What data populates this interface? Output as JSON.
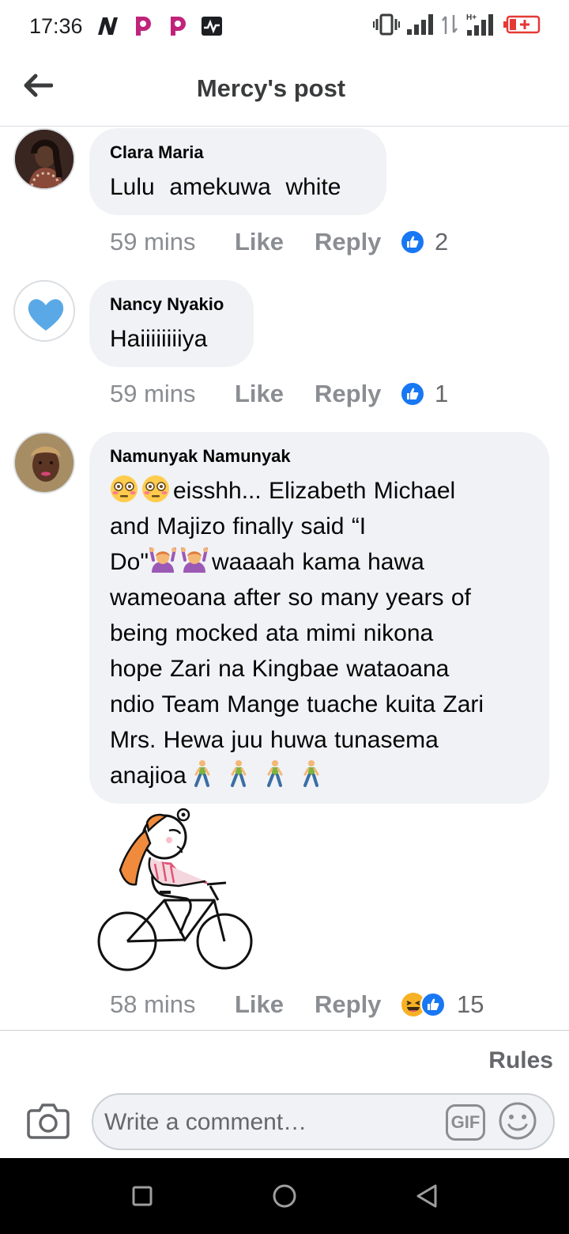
{
  "status_bar": {
    "time": "17:36",
    "left_icons": [
      "n-icon",
      "pinterest-icon",
      "pinterest-icon",
      "activity-icon"
    ],
    "right_icons": [
      "vibrate-icon",
      "signal-icon",
      "data-arrows-icon",
      "h-plus-signal-icon",
      "battery-low-icon"
    ]
  },
  "header": {
    "title": "Mercy's post",
    "back_icon": "arrow-left-icon"
  },
  "comments": [
    {
      "name": "Clara Maria",
      "text": "Lulu  amekuwa  white",
      "time": "59 mins",
      "like_label": "Like",
      "reply_label": "Reply",
      "reaction_count": "2",
      "reactions": [
        "like"
      ]
    },
    {
      "name": "Nancy Nyakio",
      "text": "Haiiiiiiiiya",
      "time": "59 mins",
      "like_label": "Like",
      "reply_label": "Reply",
      "reaction_count": "1",
      "reactions": [
        "like"
      ]
    },
    {
      "name": "Namunyak Namunyak",
      "text_lines": [
        "eisshh... Elizabeth Michael",
        "and Majizo finally said “I",
        "waaaah kama hawa",
        "wameoana after so many years of",
        "being mocked ata mimi nikona",
        "hope Zari na Kingbae wataoana",
        "ndio Team Mange tuache kuita Zari",
        "Mrs. Hewa juu huwa tunasema",
        "anajioa"
      ],
      "line3_prefix": "Do\"",
      "time": "58 mins",
      "like_label": "Like",
      "reply_label": "Reply",
      "reaction_count": "15",
      "reactions": [
        "haha",
        "like"
      ],
      "attachment": "bicycle-rider-sticker"
    }
  ],
  "footer": {
    "rules_label": "Rules",
    "comment_placeholder": "Write a comment…",
    "gif_label": "GIF"
  },
  "colors": {
    "bubble": "#f0f2f5",
    "meta_text": "#8a8d91",
    "like_blue": "#1877f2",
    "haha_yellow": "#f7b125"
  }
}
